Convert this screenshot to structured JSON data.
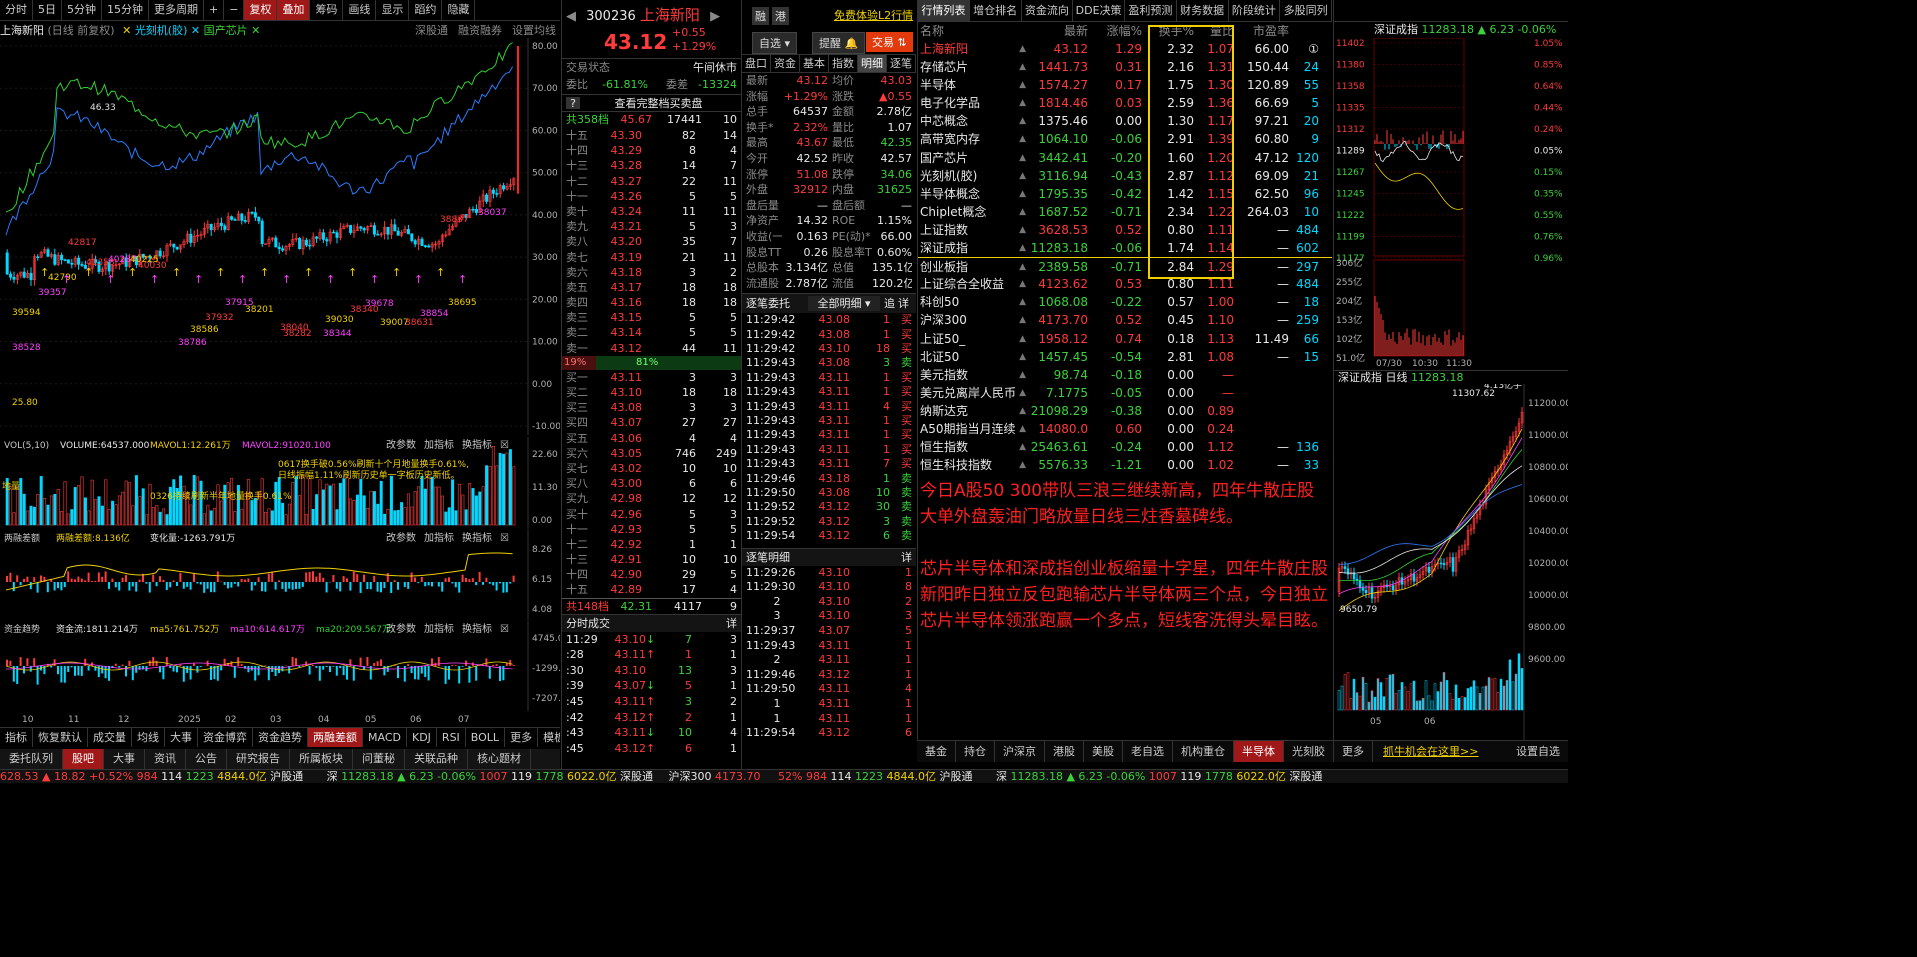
{
  "toolbar": {
    "items": [
      "分时",
      "5日",
      "5分钟",
      "15分钟",
      "更多周期",
      "+",
      "−",
      "复权",
      "叠加",
      "筹码",
      "画线",
      "显示",
      "蹈约",
      "隐藏"
    ],
    "active": [
      "复权",
      "叠加"
    ]
  },
  "chart_header": {
    "name": "上海新阳",
    "period": "(日线 前复权)",
    "overlay1": "光刻机(胶)",
    "overlay2": "国产芯片",
    "right_links": [
      "深股通",
      "融资融券",
      "设置均线"
    ]
  },
  "kline": {
    "y_ticks": [
      "80.00",
      "70.00",
      "60.00",
      "50.00",
      "40.00",
      "30.00",
      "20.00",
      "10.00",
      "0.00",
      "-10.00"
    ],
    "labels": [
      "46.33",
      "38528",
      "25.80",
      "42817",
      "39357",
      "42790",
      "41358",
      "40287",
      "40225",
      "40030",
      "38786",
      "38586",
      "37932",
      "37915",
      "38201",
      "38282",
      "38344",
      "39030",
      "38340",
      "39678",
      "39007",
      "38631",
      "38854",
      "38695",
      "38837",
      "38037",
      "39594",
      "38040"
    ]
  },
  "vol": {
    "header": "VOL(5,10)",
    "volume": "VOLUME:64537.000",
    "mavol1": "MAVOL1:12.261万",
    "mavol2": "MAVOL2:91020.100",
    "links": [
      "改参数",
      "加指标",
      "换指标"
    ],
    "y": [
      "22.60",
      "11.30",
      "0.00"
    ],
    "ann1": "0617换手破0.56%刷新十个月地量换手0.61%,",
    "ann2": "日线振幅1.11%刷新历史单一字板历史新低。",
    "ann3": "0326持续刷新半年地量换手0.61%",
    "ann4": "地量"
  },
  "margin": {
    "header": "两融差额",
    "value": "两融差额:8.136亿",
    "change": "变化量:-1263.791万",
    "links": [
      "改参数",
      "加指标",
      "换指标"
    ],
    "y": [
      "8.26",
      "6.15",
      "4.08"
    ]
  },
  "flow": {
    "header": "资金趋势",
    "value": "资金流:1811.214万",
    "ma5": "ma5:761.752万",
    "ma10": "ma10:614.617万",
    "ma20": "ma20:209.567万",
    "links": [
      "改参数",
      "加指标",
      "换指标"
    ],
    "y": [
      "4745.00",
      "-1299.00",
      "-7207.00"
    ]
  },
  "x_axis": [
    "10",
    "11",
    "12",
    "2025",
    "02",
    "03",
    "04",
    "05",
    "06",
    "07"
  ],
  "bottom_tabs": {
    "left": [
      "指标",
      "恢复默认",
      "成交量",
      "均线",
      "大事",
      "资金博弈",
      "资金趋势",
      "两融差额",
      "MACD",
      "KDJ",
      "RSI",
      "BOLL",
      "更多",
      "模板"
    ],
    "left_active": "两融差额"
  },
  "info_tabs": [
    "委托队列",
    "股吧",
    "大事",
    "资讯",
    "公告",
    "研究报告",
    "所属板块",
    "问董秘",
    "关联品种",
    "核心题材"
  ],
  "stock": {
    "code": "300236",
    "name": "上海新阳",
    "price": "43.12",
    "chg": "+0.55",
    "pct": "+1.29%",
    "tags": [
      "融",
      "港"
    ],
    "l2": "免费体验L2行情",
    "btn_zixuan": "自选",
    "btn_tixing": "提醒",
    "btn_jiaoyi": "交易"
  },
  "trade_state": {
    "label": "交易状态",
    "value": "午间休市",
    "weibi_l": "委比",
    "weibi": "-61.81%",
    "weicha_l": "委差",
    "weicha": "-13324",
    "full_btn": "查看完整档买卖盘"
  },
  "sell_total": {
    "label": "共358档",
    "price": "45.67",
    "vol": "17441",
    "n": "10"
  },
  "sells": [
    [
      "十五",
      "43.30",
      "82",
      "14"
    ],
    [
      "十四",
      "43.29",
      "8",
      "4"
    ],
    [
      "十三",
      "43.28",
      "14",
      "7"
    ],
    [
      "十二",
      "43.27",
      "22",
      "11"
    ],
    [
      "十一",
      "43.26",
      "5",
      "5"
    ],
    [
      "卖十",
      "43.24",
      "11",
      "11"
    ],
    [
      "卖九",
      "43.21",
      "5",
      "3"
    ],
    [
      "卖八",
      "43.20",
      "35",
      "7"
    ],
    [
      "卖七",
      "43.19",
      "21",
      "11"
    ],
    [
      "卖六",
      "43.18",
      "3",
      "2"
    ],
    [
      "卖五",
      "43.17",
      "18",
      "18"
    ],
    [
      "卖四",
      "43.16",
      "18",
      "18"
    ],
    [
      "卖三",
      "43.15",
      "5",
      "5"
    ],
    [
      "卖二",
      "43.14",
      "5",
      "5"
    ],
    [
      "卖一",
      "43.12",
      "44",
      "11"
    ]
  ],
  "ratio": {
    "left": "19%",
    "right": "81%"
  },
  "buys": [
    [
      "买一",
      "43.11",
      "3",
      "3"
    ],
    [
      "买二",
      "43.10",
      "18",
      "18"
    ],
    [
      "买三",
      "43.08",
      "3",
      "3"
    ],
    [
      "买四",
      "43.07",
      "27",
      "27"
    ],
    [
      "买五",
      "43.06",
      "4",
      "4"
    ],
    [
      "买六",
      "43.05",
      "746",
      "249"
    ],
    [
      "买七",
      "43.02",
      "10",
      "10"
    ],
    [
      "买八",
      "43.00",
      "6",
      "6"
    ],
    [
      "买九",
      "42.98",
      "12",
      "12"
    ],
    [
      "买十",
      "42.96",
      "5",
      "3"
    ],
    [
      "十一",
      "42.93",
      "5",
      "5"
    ],
    [
      "十二",
      "42.92",
      "1",
      "1"
    ],
    [
      "十三",
      "42.91",
      "10",
      "10"
    ],
    [
      "十四",
      "42.90",
      "29",
      "5"
    ],
    [
      "十五",
      "42.89",
      "17",
      "4"
    ]
  ],
  "buy_total": {
    "label": "共148档",
    "price": "42.31",
    "vol": "4117",
    "n": "9"
  },
  "fenshi": {
    "title": "分时成交",
    "more": "详",
    "rows": [
      [
        "11:29",
        "43.10",
        "↓",
        "7",
        "3"
      ],
      [
        ":28",
        "43.11",
        "↑",
        "1",
        "1"
      ],
      [
        ":30",
        "43.10",
        "",
        "13",
        "3"
      ],
      [
        ":39",
        "43.07",
        "↓",
        "5",
        "1"
      ],
      [
        ":45",
        "43.11",
        "↑",
        "3",
        "2"
      ],
      [
        ":42",
        "43.12",
        "↑",
        "2",
        "1"
      ],
      [
        ":43",
        "43.11",
        "↓",
        "10",
        "4"
      ],
      [
        ":45",
        "43.12",
        "↑",
        "6",
        "1"
      ]
    ]
  },
  "quote_tabs": [
    "盘口",
    "资金",
    "基本",
    "指数",
    "明细",
    "逐笔"
  ],
  "quote_active": "明细",
  "quote": [
    [
      "最新",
      "43.12",
      "均价",
      "43.03"
    ],
    [
      "涨幅",
      "+1.29%",
      "涨跌",
      "▲0.55"
    ],
    [
      "总手",
      "64537",
      "金额",
      "2.78亿"
    ],
    [
      "换手*",
      "2.32%",
      "量比",
      "1.07"
    ],
    [
      "最高",
      "43.67",
      "最低",
      "42.35"
    ],
    [
      "今开",
      "42.52",
      "昨收",
      "42.57"
    ],
    [
      "涨停",
      "51.08",
      "跌停",
      "34.06"
    ],
    [
      "外盘",
      "32912",
      "内盘",
      "31625"
    ],
    [
      "盘后量",
      "—",
      "盘后额",
      "—"
    ],
    [
      "净资产",
      "14.32",
      "ROE",
      "1.15%"
    ],
    [
      "收益(一)",
      "0.163",
      "PE(动)*",
      "66.00"
    ],
    [
      "股息TTM",
      "0.26",
      "股息率TTM",
      "0.60%"
    ],
    [
      "总股本",
      "3.134亿",
      "总值",
      "135.1亿"
    ],
    [
      "流通股",
      "2.787亿",
      "流值",
      "120.2亿"
    ]
  ],
  "zhubi_wt": {
    "title": "逐笔委托",
    "filter": "全部明细",
    "btns": [
      "追",
      "详"
    ],
    "rows": [
      [
        "11:29:42",
        "43.08",
        "1",
        "买"
      ],
      [
        "11:29:42",
        "43.08",
        "1",
        "买"
      ],
      [
        "11:29:42",
        "43.10",
        "18",
        "买"
      ],
      [
        "11:29:43",
        "43.08",
        "3",
        "卖"
      ],
      [
        "11:29:43",
        "43.11",
        "1",
        "买"
      ],
      [
        "11:29:43",
        "43.11",
        "1",
        "买"
      ],
      [
        "11:29:43",
        "43.11",
        "4",
        "买"
      ],
      [
        "11:29:43",
        "43.11",
        "1",
        "买"
      ],
      [
        "11:29:43",
        "43.11",
        "1",
        "买"
      ],
      [
        "11:29:43",
        "43.11",
        "1",
        "买"
      ],
      [
        "11:29:43",
        "43.11",
        "7",
        "买"
      ],
      [
        "11:29:46",
        "43.18",
        "1",
        "卖"
      ],
      [
        "11:29:50",
        "43.08",
        "10",
        "卖"
      ],
      [
        "11:29:52",
        "43.12",
        "30",
        "卖"
      ],
      [
        "11:29:52",
        "43.12",
        "3",
        "卖"
      ],
      [
        "11:29:54",
        "43.12",
        "6",
        "卖"
      ]
    ]
  },
  "zhubi_mx": {
    "title": "逐笔明细",
    "more": "详",
    "rows": [
      [
        "11:29:26",
        "43.10",
        "1"
      ],
      [
        "11:29:30",
        "43.10",
        "8"
      ],
      [
        "2",
        "43.10",
        "2"
      ],
      [
        "3",
        "43.10",
        "3"
      ],
      [
        "11:29:37",
        "43.07",
        "5"
      ],
      [
        "11:29:43",
        "43.11",
        "1"
      ],
      [
        "2",
        "43.11",
        "1"
      ],
      [
        "11:29:46",
        "43.12",
        "1"
      ],
      [
        "11:29:50",
        "43.11",
        "4"
      ],
      [
        "1",
        "43.11",
        "1"
      ],
      [
        "1",
        "43.11",
        "1"
      ],
      [
        "11:29:54",
        "43.12",
        "6"
      ]
    ]
  },
  "market_tabs": [
    "行情列表",
    "增仓排名",
    "资金流向",
    "DDE决策",
    "盈利预测",
    "财务数据",
    "阶段统计",
    "多股同列"
  ],
  "market_cols": [
    "名称",
    "最新",
    "涨幅%",
    "换手%",
    "量比",
    "市盈率"
  ],
  "market_rows": [
    [
      "上海新阳",
      "43.12",
      "1.29",
      "2.32",
      "1.07",
      "66.00",
      "①"
    ],
    [
      "存储芯片",
      "1441.73",
      "0.31",
      "2.16",
      "1.31",
      "150.44",
      "24"
    ],
    [
      "半导体",
      "1574.27",
      "0.17",
      "1.75",
      "1.30",
      "120.89",
      "55"
    ],
    [
      "电子化学品",
      "1814.46",
      "0.03",
      "2.59",
      "1.36",
      "66.69",
      "5"
    ],
    [
      "中芯概念",
      "1375.46",
      "0.00",
      "1.30",
      "1.17",
      "97.21",
      "20"
    ],
    [
      "高带宽内存",
      "1064.10",
      "-0.06",
      "2.91",
      "1.39",
      "60.80",
      "9"
    ],
    [
      "国产芯片",
      "3442.41",
      "-0.20",
      "1.60",
      "1.20",
      "47.12",
      "120"
    ],
    [
      "光刻机(胶)",
      "3116.94",
      "-0.43",
      "2.87",
      "1.12",
      "69.09",
      "21"
    ],
    [
      "半导体概念",
      "1795.35",
      "-0.42",
      "1.42",
      "1.15",
      "62.50",
      "96"
    ],
    [
      "Chiplet概念",
      "1687.52",
      "-0.71",
      "2.34",
      "1.22",
      "264.03",
      "10"
    ],
    [
      "上证指数",
      "3628.53",
      "0.52",
      "0.80",
      "1.11",
      "—",
      "484"
    ],
    [
      "深证成指",
      "11283.18",
      "-0.06",
      "1.74",
      "1.14",
      "—",
      "602"
    ],
    [
      "创业板指",
      "2389.58",
      "-0.71",
      "2.84",
      "1.29",
      "—",
      "297"
    ],
    [
      "上证综合全收益",
      "4123.62",
      "0.53",
      "0.80",
      "1.11",
      "—",
      "484"
    ],
    [
      "科创50",
      "1068.08",
      "-0.22",
      "0.57",
      "1.00",
      "—",
      "18"
    ],
    [
      "沪深300",
      "4173.70",
      "0.52",
      "0.45",
      "1.10",
      "—",
      "259"
    ],
    [
      "上证50_",
      "1958.12",
      "0.74",
      "0.18",
      "1.13",
      "11.49",
      "66"
    ],
    [
      "北证50",
      "1457.45",
      "-0.54",
      "2.81",
      "1.08",
      "—",
      "15"
    ],
    [
      "美元指数",
      "98.74",
      "-0.18",
      "0.00",
      "—",
      "",
      ""
    ],
    [
      "美元兑离岸人民币",
      "7.1775",
      "-0.05",
      "0.00",
      "—",
      "",
      ""
    ],
    [
      "纳斯达克",
      "21098.29",
      "-0.38",
      "0.00",
      "0.89",
      "",
      ""
    ],
    [
      "A50期指当月连续",
      "14080.0",
      "0.60",
      "0.00",
      "0.24",
      "",
      ""
    ],
    [
      "恒生指数",
      "25463.61",
      "-0.24",
      "0.00",
      "1.12",
      "—",
      "136"
    ],
    [
      "恒生科技指数",
      "5576.33",
      "-1.21",
      "0.00",
      "1.02",
      "—",
      "33"
    ]
  ],
  "commentary": {
    "p1": "今日A股50 300带队三浪三继续新高，四年牛散庄股大单外盘轰油门略放量日线三炷香墓碑线。",
    "p2": "芯片半导体和深成指创业板缩量十字星，四年牛散庄股新阳昨日独立反包跑输芯片半导体两三个点，今日独立芯片半导体领涨跑赢一个多点，短线客洗得头晕目眩。"
  },
  "mini_intraday": {
    "title": "深证成指",
    "price": "11283.18",
    "chg": "▲ 6.23",
    "pct": "-0.06%",
    "left_y": [
      "11402",
      "11380",
      "11358",
      "11335",
      "11312",
      "11289",
      "11267",
      "11245",
      "11222",
      "11199",
      "11177"
    ],
    "right_y": [
      "1.05%",
      "0.85%",
      "0.64%",
      "0.44%",
      "0.24%",
      "0.05%",
      "0.15%",
      "0.35%",
      "0.55%",
      "0.76%",
      "0.96%"
    ],
    "vol_y": [
      "306亿",
      "255亿",
      "204亿",
      "153亿",
      "102亿",
      "51.0亿"
    ],
    "x": [
      "07/30",
      "10:30",
      "11:30"
    ]
  },
  "mini_daily": {
    "title": "深证成指 日线",
    "price": "11283.18",
    "vol_label": "4.13亿手",
    "high": "11307.62",
    "low": "9650.79",
    "y": [
      "11200.00",
      "11000.00",
      "10800.00",
      "10600.00",
      "10400.00",
      "10200.00",
      "10000.00",
      "9800.00",
      "9600.00"
    ],
    "x": [
      "05",
      "06"
    ]
  },
  "block_tabs": [
    "基金",
    "持仓",
    "沪深京",
    "港股",
    "美股",
    "老自选",
    "机构重仓",
    "半导体",
    "光刻胶",
    "更多"
  ],
  "block_active": "半导体",
  "block_link": "抓牛机会在这里>>",
  "block_settings": "设置自选",
  "middle_info_tabs": [
    "资讯",
    "公告",
    "研究报告"
  ],
  "status": {
    "left1": "628.53",
    "left2": "▲ 18.82",
    "left3": "+0.52%",
    "left4": "984",
    "left5": "114",
    "left6": "1223",
    "left7": "4844.0亿",
    "hgt": "沪股通",
    "s1": "深",
    "s2": "11283.18",
    "s3": "▲ 6.23",
    "s4": "-0.06%",
    "s5": "1007",
    "s6": "119",
    "s7": "1778",
    "s8": "6022.0亿",
    "sgt": "深股通",
    "hs": "沪深300",
    "hsv": "4173.70",
    "r1": "52%",
    "r2": "984",
    "r3": "114",
    "r4": "1223",
    "r5": "4844.0亿",
    "r6": "沪股通",
    "r7": "深",
    "r8": "11283.18",
    "r9": "▲ 6.23",
    "r10": "-0.06%",
    "r11": "1007",
    "r12": "119",
    "r13": "1778",
    "r14": "6022.0亿",
    "r15": "深股通"
  },
  "colors": {
    "up": "#ff3b3b",
    "down": "#3bd23b",
    "cyan": "#00d8ff",
    "yellow": "#f0d000",
    "tab_active": "#a01818"
  }
}
